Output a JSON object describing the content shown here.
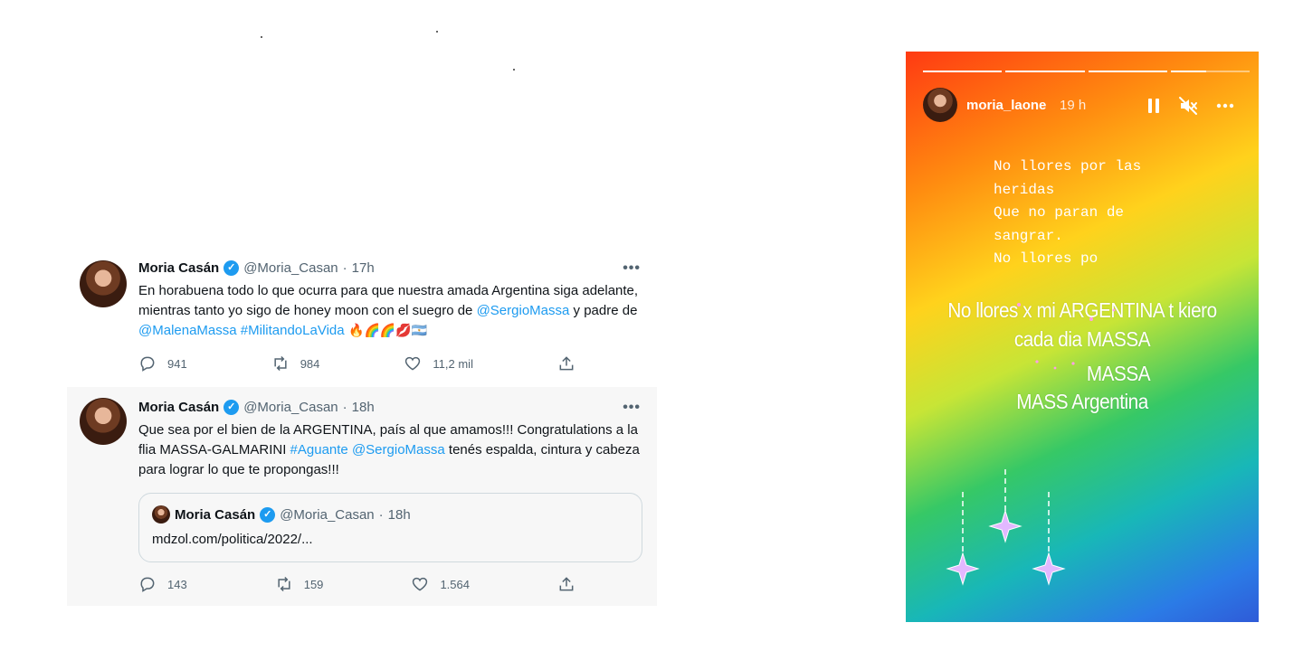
{
  "tweets": [
    {
      "name": "Moria Casán",
      "handle": "@Moria_Casan",
      "dot": "·",
      "time": "17h",
      "more": "•••",
      "text_a": "En horabuena todo lo que ocurra para que nuestra amada Argentina siga adelante, mientras tanto yo sigo de honey moon con el suegro de ",
      "link_a": "@SergioMassa",
      "text_b": " y padre de ",
      "link_b": "@MalenaMassa",
      "text_c": " ",
      "link_c": "#MilitandoLaVida",
      "emojis": " 🔥🌈🌈💋🇦🇷",
      "replies": "941",
      "retweets": "984",
      "likes": "11,2 mil"
    },
    {
      "name": "Moria Casán",
      "handle": "@Moria_Casan",
      "dot": "·",
      "time": "18h",
      "more": "•••",
      "text_a": "Que sea por el bien de la ARGENTINA, país al que amamos!!! Congratulations a la flia MASSA-GALMARINI ",
      "link_a": "#Aguante",
      "text_b": " ",
      "link_b": "@SergioMassa",
      "text_c": " tenés espalda, cintura y cabeza para lograr lo que te propongas!!!",
      "quote": {
        "name": "Moria Casán",
        "handle": "@Moria_Casan",
        "dot": "·",
        "time": "18h",
        "url": "mdzol.com/politica/2022/..."
      },
      "replies": "143",
      "retweets": "159",
      "likes": "1.564"
    }
  ],
  "story": {
    "username": "moria_laone",
    "time": "19 h",
    "poem": "No llores por las\nheridas\nQue no paran de\nsangrar.\nNo llores po",
    "captions": [
      "No llores x mi ARGENTINA t kiero",
      "cada dia MASSA",
      "MASSA",
      "MASS Argentina"
    ],
    "gradient": [
      "#ff3a12",
      "#ff8d10",
      "#ffd21c",
      "#c7e536",
      "#36c866",
      "#18b7b8",
      "#2b7be6"
    ]
  },
  "colors": {
    "link": "#1d9bf0",
    "verified": "#1d9bf0",
    "muted": "#536471"
  }
}
